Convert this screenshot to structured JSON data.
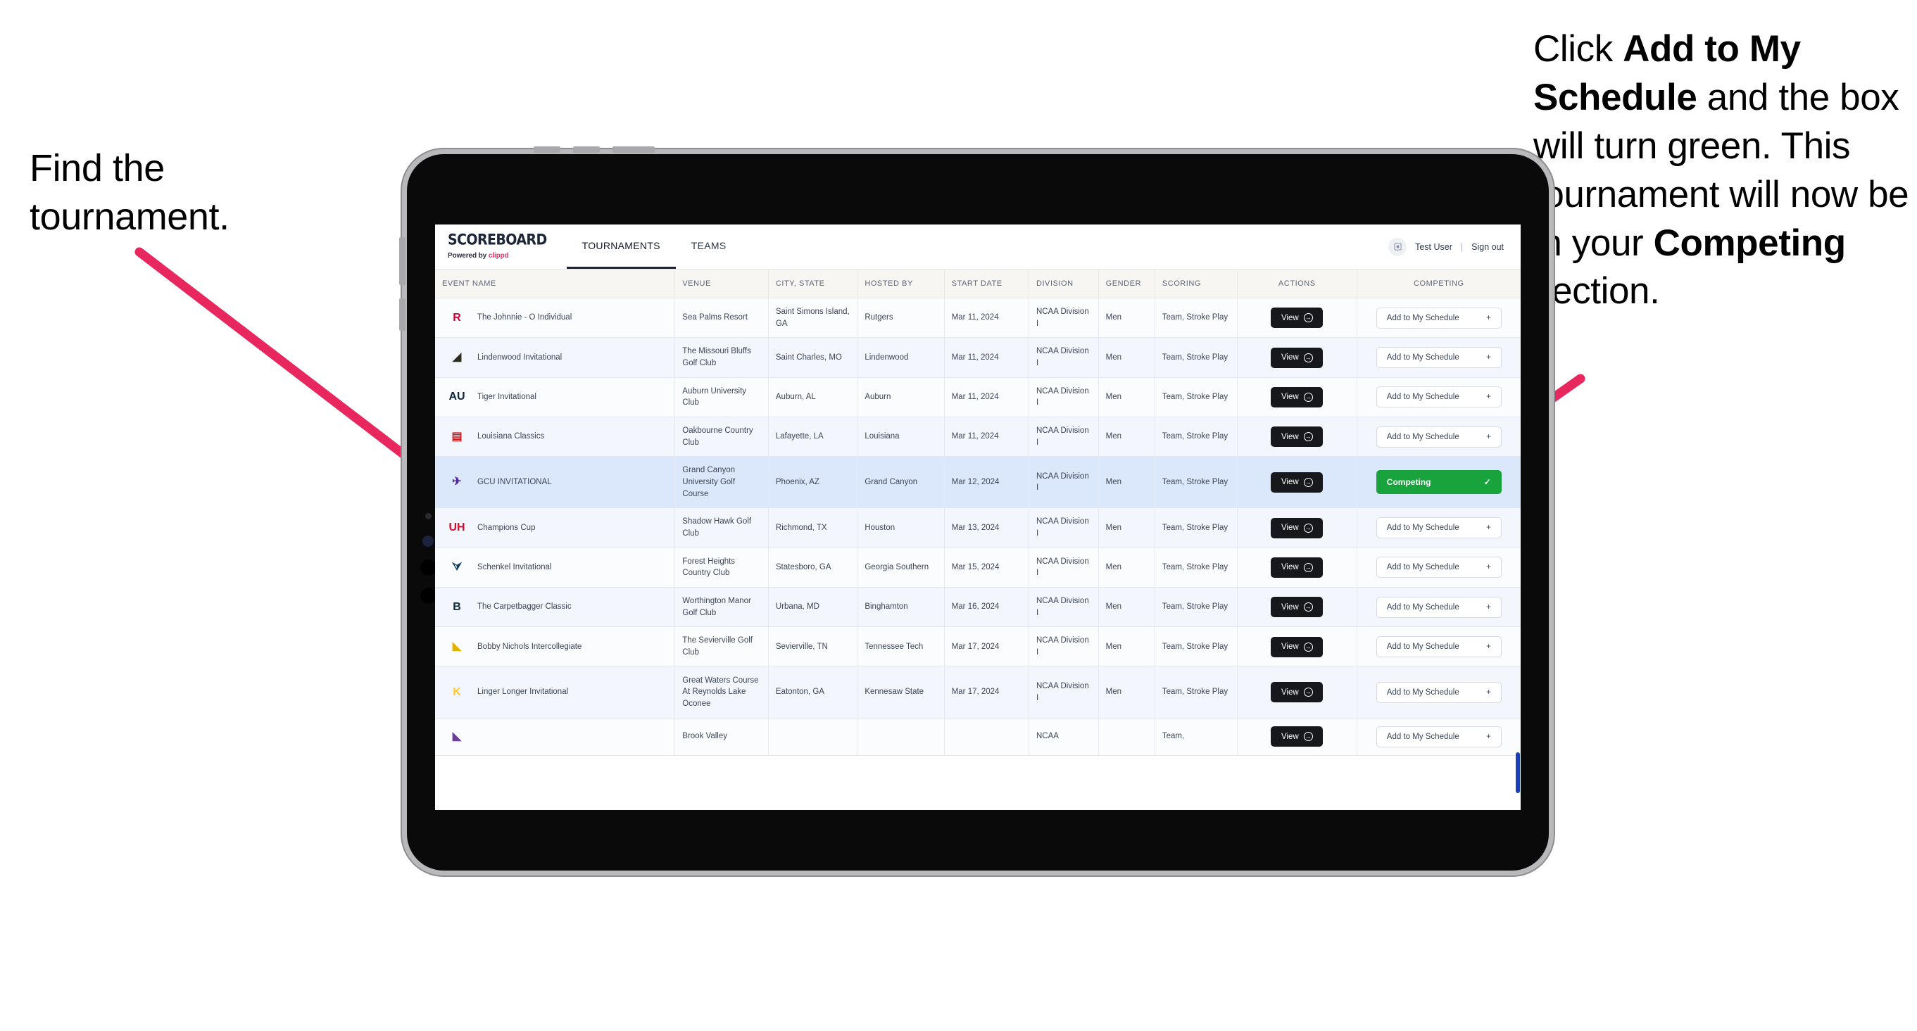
{
  "annotations": {
    "left": {
      "line1": "Find the",
      "line2": "tournament."
    },
    "right": {
      "seg1": "Click ",
      "bold1": "Add to My Schedule",
      "seg2": " and the box will turn green. This tournament will now be in your ",
      "bold2": "Competing",
      "seg3": " section."
    },
    "arrow_color": "#e8275f"
  },
  "app": {
    "brand": {
      "title": "SCOREBOARD",
      "powered_prefix": "Powered by ",
      "powered_brand": "clippd"
    },
    "nav_tabs": [
      {
        "label": "TOURNAMENTS",
        "active": true
      },
      {
        "label": "TEAMS",
        "active": false
      }
    ],
    "header_right": {
      "avatar_icon": "user-badge-icon",
      "user_name": "Test User",
      "separator": "|",
      "sign_out": "Sign out"
    },
    "table": {
      "columns": [
        "EVENT NAME",
        "VENUE",
        "CITY, STATE",
        "HOSTED BY",
        "START DATE",
        "DIVISION",
        "GENDER",
        "SCORING",
        "ACTIONS",
        "COMPETING"
      ],
      "action_label": "View",
      "add_label": "Add to My Schedule",
      "add_icon": "plus-icon",
      "competing_label": "Competing",
      "competing_icon": "check-icon",
      "competing_color": "#18a33d",
      "rows": [
        {
          "event": "The Johnnie - O Individual",
          "logo_text": "R",
          "logo_color": "#cc0033",
          "venue": "Sea Palms Resort",
          "city": "Saint Simons Island, GA",
          "host": "Rutgers",
          "date": "Mar 11, 2024",
          "division": "NCAA Division I",
          "gender": "Men",
          "scoring": "Team, Stroke Play",
          "competing": false
        },
        {
          "event": "Lindenwood Invitational",
          "logo_text": "◢",
          "logo_color": "#2b2b20",
          "venue": "The Missouri Bluffs Golf Club",
          "city": "Saint Charles, MO",
          "host": "Lindenwood",
          "date": "Mar 11, 2024",
          "division": "NCAA Division I",
          "gender": "Men",
          "scoring": "Team, Stroke Play",
          "competing": false
        },
        {
          "event": "Tiger Invitational",
          "logo_text": "AU",
          "logo_color": "#0c2340",
          "venue": "Auburn University Club",
          "city": "Auburn, AL",
          "host": "Auburn",
          "date": "Mar 11, 2024",
          "division": "NCAA Division I",
          "gender": "Men",
          "scoring": "Team, Stroke Play",
          "competing": false
        },
        {
          "event": "Louisiana Classics",
          "logo_text": "▤",
          "logo_color": "#ce181e",
          "venue": "Oakbourne Country Club",
          "city": "Lafayette, LA",
          "host": "Louisiana",
          "date": "Mar 11, 2024",
          "division": "NCAA Division I",
          "gender": "Men",
          "scoring": "Team, Stroke Play",
          "competing": false
        },
        {
          "event": "GCU INVITATIONAL",
          "logo_text": "✈",
          "logo_color": "#522398",
          "venue": "Grand Canyon University Golf Course",
          "city": "Phoenix, AZ",
          "host": "Grand Canyon",
          "date": "Mar 12, 2024",
          "division": "NCAA Division I",
          "gender": "Men",
          "scoring": "Team, Stroke Play",
          "competing": true
        },
        {
          "event": "Champions Cup",
          "logo_text": "UH",
          "logo_color": "#c8102e",
          "venue": "Shadow Hawk Golf Club",
          "city": "Richmond, TX",
          "host": "Houston",
          "date": "Mar 13, 2024",
          "division": "NCAA Division I",
          "gender": "Men",
          "scoring": "Team, Stroke Play",
          "competing": false
        },
        {
          "event": "Schenkel Invitational",
          "logo_text": "⮛",
          "logo_color": "#0b3a5d",
          "venue": "Forest Heights Country Club",
          "city": "Statesboro, GA",
          "host": "Georgia Southern",
          "date": "Mar 15, 2024",
          "division": "NCAA Division I",
          "gender": "Men",
          "scoring": "Team, Stroke Play",
          "competing": false
        },
        {
          "event": "The Carpetbagger Classic",
          "logo_text": "B",
          "logo_color": "#0d2a3a",
          "venue": "Worthington Manor Golf Club",
          "city": "Urbana, MD",
          "host": "Binghamton",
          "date": "Mar 16, 2024",
          "division": "NCAA Division I",
          "gender": "Men",
          "scoring": "Team, Stroke Play",
          "competing": false
        },
        {
          "event": "Bobby Nichols Intercollegiate",
          "logo_text": "◣",
          "logo_color": "#e0b400",
          "venue": "The Sevierville Golf Club",
          "city": "Sevierville, TN",
          "host": "Tennessee Tech",
          "date": "Mar 17, 2024",
          "division": "NCAA Division I",
          "gender": "Men",
          "scoring": "Team, Stroke Play",
          "competing": false
        },
        {
          "event": "Linger Longer Invitational",
          "logo_text": "K",
          "logo_color": "#ffc82e",
          "venue": "Great Waters Course At Reynolds Lake Oconee",
          "city": "Eatonton, GA",
          "host": "Kennesaw State",
          "date": "Mar 17, 2024",
          "division": "NCAA Division I",
          "gender": "Men",
          "scoring": "Team, Stroke Play",
          "competing": false
        },
        {
          "event": "",
          "logo_text": "◣",
          "logo_color": "#6c3f99",
          "venue": "Brook Valley",
          "city": "",
          "host": "",
          "date": "",
          "division": "NCAA",
          "gender": "",
          "scoring": "Team,",
          "competing": false
        }
      ]
    }
  }
}
